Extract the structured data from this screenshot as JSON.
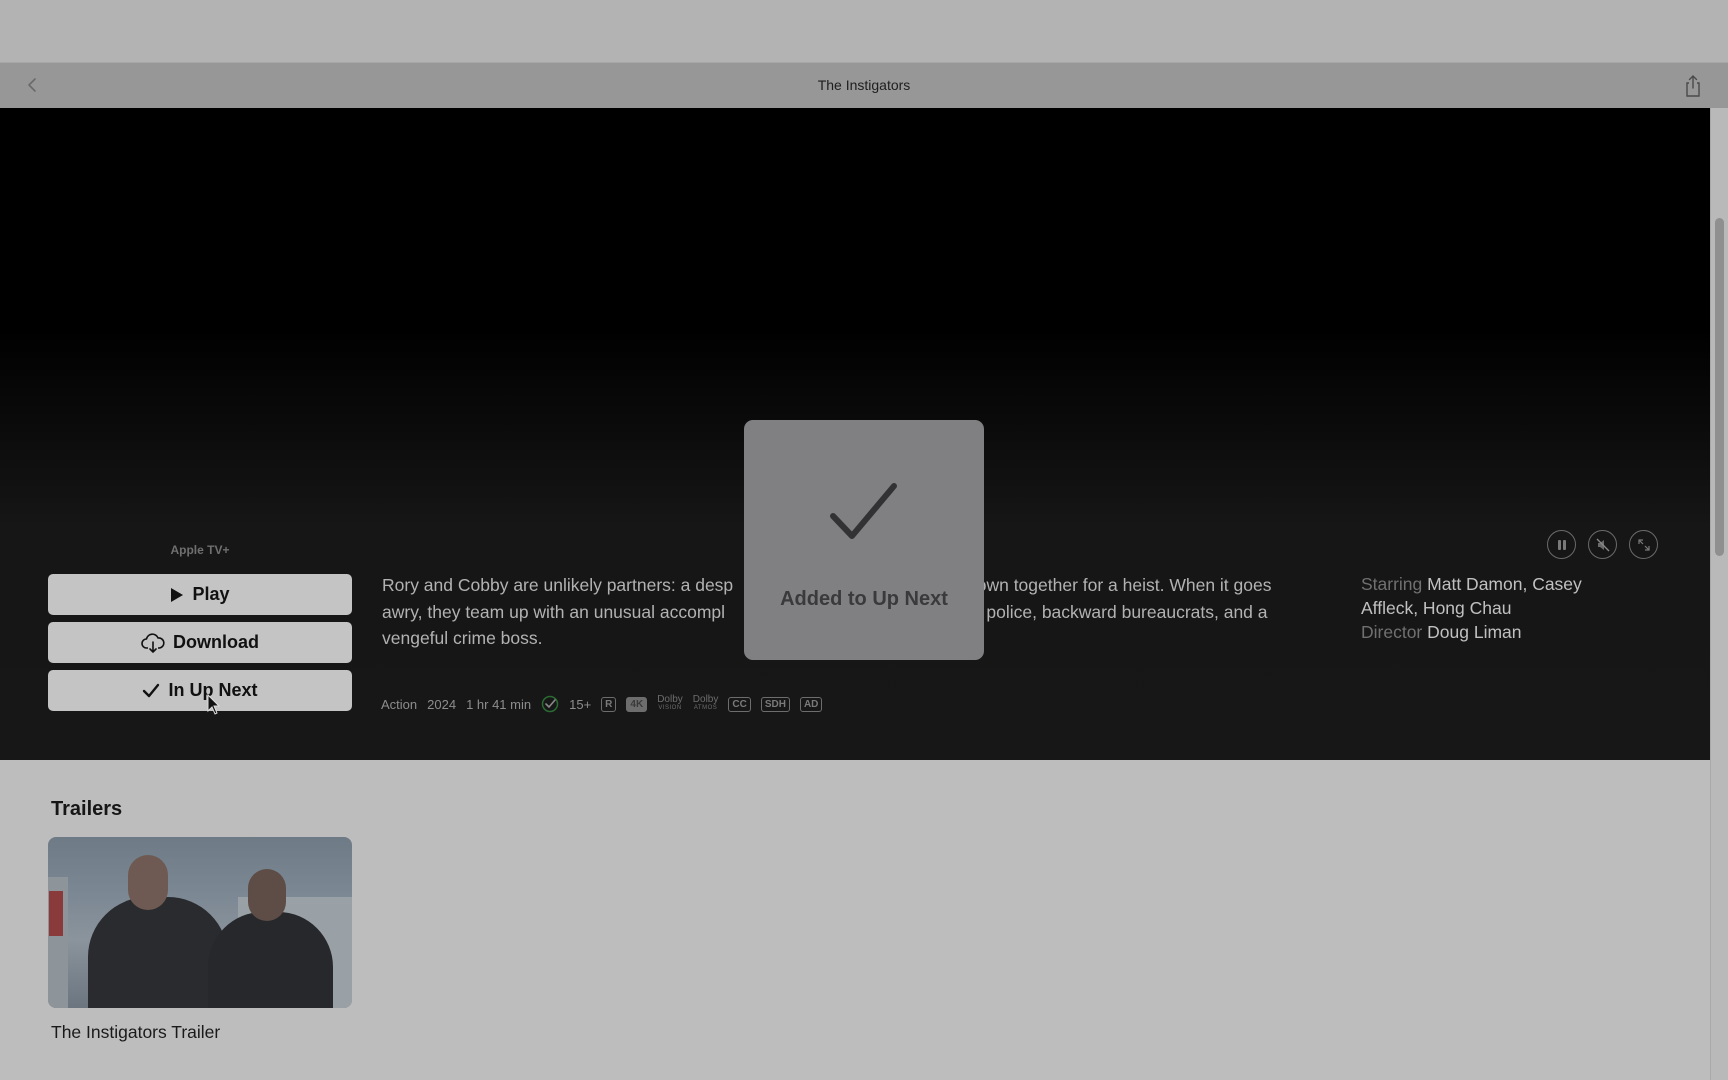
{
  "window": {
    "title": "The Instigators",
    "back_icon": "chevron-left-icon",
    "share_icon": "share-icon"
  },
  "hero": {
    "provider": "Apple TV+",
    "buttons": {
      "play": "Play",
      "download": "Download",
      "up_next": "In Up Next"
    },
    "description": "Rory and Cobby are unlikely partners: a desperate father and an ex-Marine, thrown together for a heist. When it goes awry, they team up with an unusual accomplice while on the run from the police, backward bureaucrats, and a vengeful crime boss.",
    "description_visible_left": [
      "Rory and Cobby are unlikely partners: a desp",
      "awry, they team up with an unusual accompl",
      "vengeful crime boss."
    ],
    "description_visible_right": [
      "hrown together for a heist. When it goes",
      "un police, backward bureaucrats, and a"
    ],
    "meta": {
      "genre": "Action",
      "year": "2024",
      "duration": "1 hr 41 min",
      "age_rating": "15+",
      "badges": [
        "R",
        "4K",
        "CC",
        "SDH",
        "AD"
      ],
      "dolby_vision": {
        "top": "Dolby",
        "bottom": "VISION"
      },
      "dolby_atmos": {
        "top": "Dolby",
        "bottom": "ATMOS"
      },
      "verified_color": "#2f8f3a"
    },
    "credits": {
      "starring_label": "Starring",
      "starring": "Matt Damon, Casey Affleck, Hong Chau",
      "director_label": "Director",
      "director": "Doug Liman"
    },
    "controls": [
      "pause-icon",
      "mute-icon",
      "expand-icon"
    ]
  },
  "hud": {
    "message": "Added to Up Next",
    "icon": "checkmark-icon"
  },
  "trailers": {
    "title": "Trailers",
    "items": [
      {
        "title": "The Instigators Trailer"
      }
    ]
  }
}
